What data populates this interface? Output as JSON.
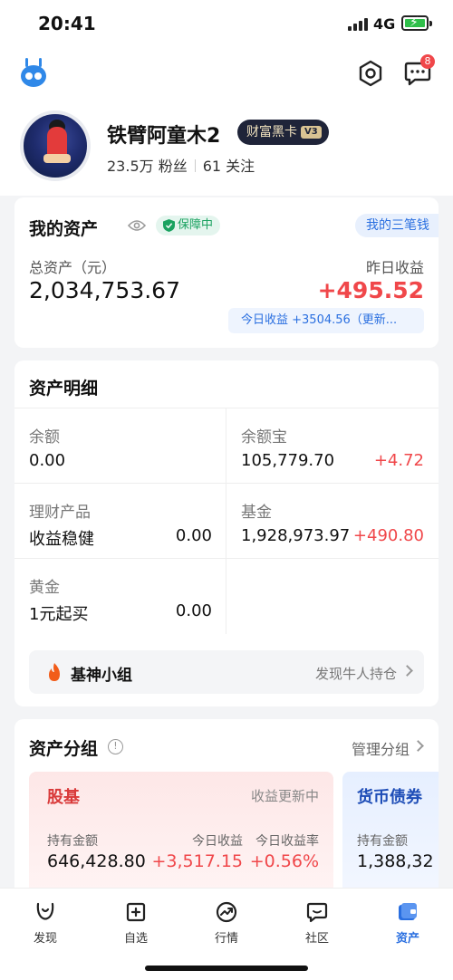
{
  "status_bar": {
    "time": "20:41",
    "network": "4G"
  },
  "header": {
    "message_badge": "8",
    "profile": {
      "name": "铁臂阿童木2",
      "vip_label": "财富黑卡",
      "vip_level": "V3",
      "fans": "23.5万 粉丝",
      "following": "61 关注"
    }
  },
  "assets": {
    "title": "我的资产",
    "secure_label": "保障中",
    "three_money": "我的三笔钱",
    "total_label": "总资产（元）",
    "total_value": "2,034,753.67",
    "yesterday_label": "昨日收益",
    "yesterday_value": "+495.52",
    "today_text": "今日收益 +3504.56（更新..."
  },
  "detail": {
    "title": "资产明细",
    "items": [
      {
        "label": "余额",
        "amount": "0.00"
      },
      {
        "label": "余额宝",
        "amount": "105,779.70",
        "gain": "+4.72"
      },
      {
        "label": "理财产品",
        "sub": "收益稳健",
        "amount": "0.00"
      },
      {
        "label": "基金",
        "amount": "1,928,973.97",
        "gain": "+490.80"
      },
      {
        "label": "黄金",
        "sub": "1元起买",
        "amount": "0.00"
      }
    ],
    "group_name": "基神小组",
    "group_link": "发现牛人持仓"
  },
  "asset_group": {
    "title": "资产分组",
    "manage": "管理分组",
    "fund": {
      "name": "股基",
      "status": "收益更新中",
      "hold_label": "持有金额",
      "hold_value": "646,428.80",
      "today_label": "今日收益",
      "today_value": "+3,517.15",
      "rate_label": "今日收益率",
      "rate_value": "+0.56%"
    },
    "bond": {
      "name": "货币债券",
      "hold_label": "持有金额",
      "hold_value": "1,388,32"
    }
  },
  "tabs": [
    {
      "label": "发现"
    },
    {
      "label": "自选"
    },
    {
      "label": "行情"
    },
    {
      "label": "社区"
    },
    {
      "label": "资产"
    }
  ],
  "colors": {
    "accent": "#2a6fe0",
    "gain": "#f0474a",
    "secure": "#1aa260"
  }
}
